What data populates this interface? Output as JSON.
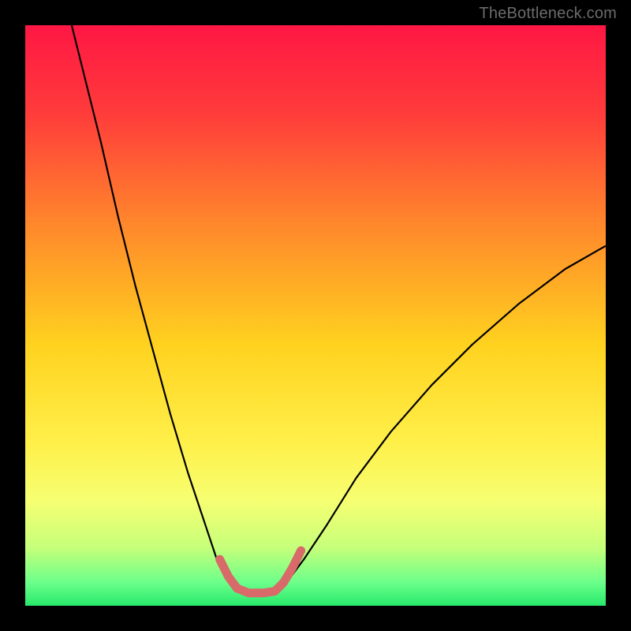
{
  "watermark": "TheBottleneck.com",
  "chart_data": {
    "type": "line",
    "title": "",
    "xlabel": "",
    "ylabel": "",
    "xlim": [
      0,
      100
    ],
    "ylim": [
      0,
      100
    ],
    "gradient_stops": [
      {
        "offset": 0.0,
        "color": "#ff1744"
      },
      {
        "offset": 0.15,
        "color": "#ff3b3b"
      },
      {
        "offset": 0.35,
        "color": "#ff8a2b"
      },
      {
        "offset": 0.55,
        "color": "#ffd21f"
      },
      {
        "offset": 0.72,
        "color": "#fff04a"
      },
      {
        "offset": 0.82,
        "color": "#f6ff72"
      },
      {
        "offset": 0.9,
        "color": "#c6ff7a"
      },
      {
        "offset": 0.96,
        "color": "#6bff8a"
      },
      {
        "offset": 1.0,
        "color": "#27e96b"
      }
    ],
    "series": [
      {
        "name": "left-branch",
        "stroke": "#000000",
        "stroke_width": 2.2,
        "points": [
          {
            "x": 8.0,
            "y": 100.0
          },
          {
            "x": 10.0,
            "y": 92.0
          },
          {
            "x": 13.0,
            "y": 80.0
          },
          {
            "x": 16.0,
            "y": 67.0
          },
          {
            "x": 19.0,
            "y": 55.0
          },
          {
            "x": 22.0,
            "y": 44.0
          },
          {
            "x": 25.0,
            "y": 33.0
          },
          {
            "x": 28.0,
            "y": 23.0
          },
          {
            "x": 31.0,
            "y": 14.0
          },
          {
            "x": 33.0,
            "y": 8.0
          },
          {
            "x": 35.0,
            "y": 4.0
          }
        ]
      },
      {
        "name": "right-branch",
        "stroke": "#000000",
        "stroke_width": 2.2,
        "points": [
          {
            "x": 45.0,
            "y": 4.0
          },
          {
            "x": 48.0,
            "y": 8.0
          },
          {
            "x": 52.0,
            "y": 14.0
          },
          {
            "x": 57.0,
            "y": 22.0
          },
          {
            "x": 63.0,
            "y": 30.0
          },
          {
            "x": 70.0,
            "y": 38.0
          },
          {
            "x": 77.0,
            "y": 45.0
          },
          {
            "x": 85.0,
            "y": 52.0
          },
          {
            "x": 93.0,
            "y": 58.0
          },
          {
            "x": 100.0,
            "y": 62.0
          }
        ]
      },
      {
        "name": "valley-marker",
        "stroke": "#d86a6a",
        "stroke_width": 11,
        "linecap": "round",
        "points": [
          {
            "x": 33.5,
            "y": 8.0
          },
          {
            "x": 35.0,
            "y": 5.0
          },
          {
            "x": 36.5,
            "y": 3.0
          },
          {
            "x": 38.5,
            "y": 2.2
          },
          {
            "x": 41.0,
            "y": 2.2
          },
          {
            "x": 43.0,
            "y": 2.5
          },
          {
            "x": 44.5,
            "y": 4.0
          },
          {
            "x": 46.0,
            "y": 6.5
          },
          {
            "x": 47.5,
            "y": 9.5
          }
        ]
      }
    ]
  }
}
